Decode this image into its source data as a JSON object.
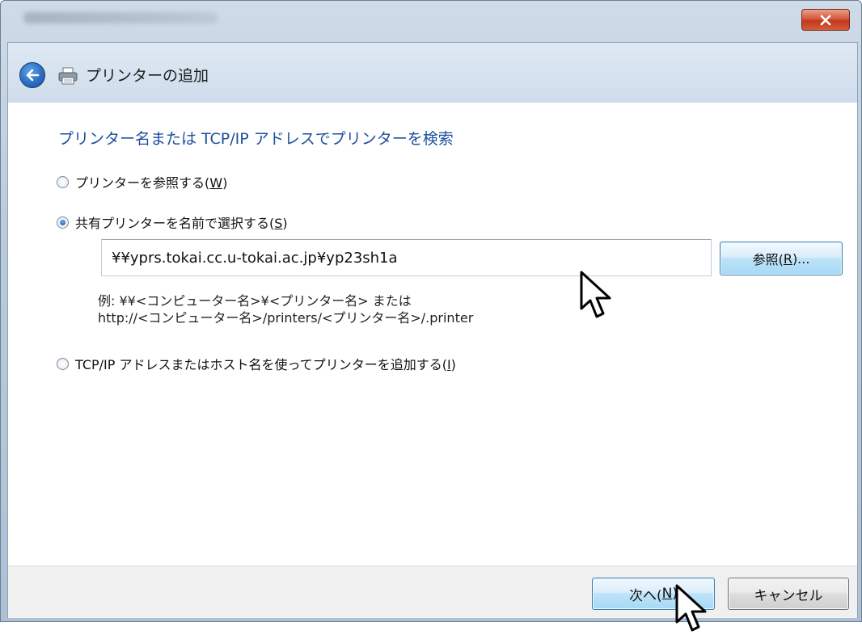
{
  "window": {
    "title": "プリンターの追加",
    "close_glyph": "X"
  },
  "heading": "プリンター名または TCP/IP アドレスでプリンターを検索",
  "options": [
    {
      "label": "プリンターを参照する(",
      "accel": "W",
      "suffix": ")",
      "checked": false
    },
    {
      "label": "共有プリンターを名前で選択する(",
      "accel": "S",
      "suffix": ")",
      "checked": true
    },
    {
      "label": "TCP/IP アドレスまたはホスト名を使ってプリンターを追加する(",
      "accel": "I",
      "suffix": ")",
      "checked": false
    }
  ],
  "shared_printer_input": {
    "value": "¥¥yprs.tokai.cc.u-tokai.ac.jp¥yp23sh1a"
  },
  "browse_button": {
    "label": "参照(",
    "accel": "R",
    "suffix": ")..."
  },
  "example": {
    "line1": "例: ¥¥<コンピューター名>¥<プリンター名> または",
    "line2": "http://<コンピューター名>/printers/<プリンター名>/.printer"
  },
  "footer": {
    "next": {
      "label": "次へ(",
      "accel": "N",
      "suffix": ")"
    },
    "cancel": "キャンセル"
  },
  "colors": {
    "heading": "#1e4f9b",
    "close_button": "#c2391b",
    "button_hover": "#bde3f8"
  },
  "icons": [
    "back-arrow-icon",
    "printer-icon",
    "close-icon",
    "mouse-cursor-icon"
  ]
}
